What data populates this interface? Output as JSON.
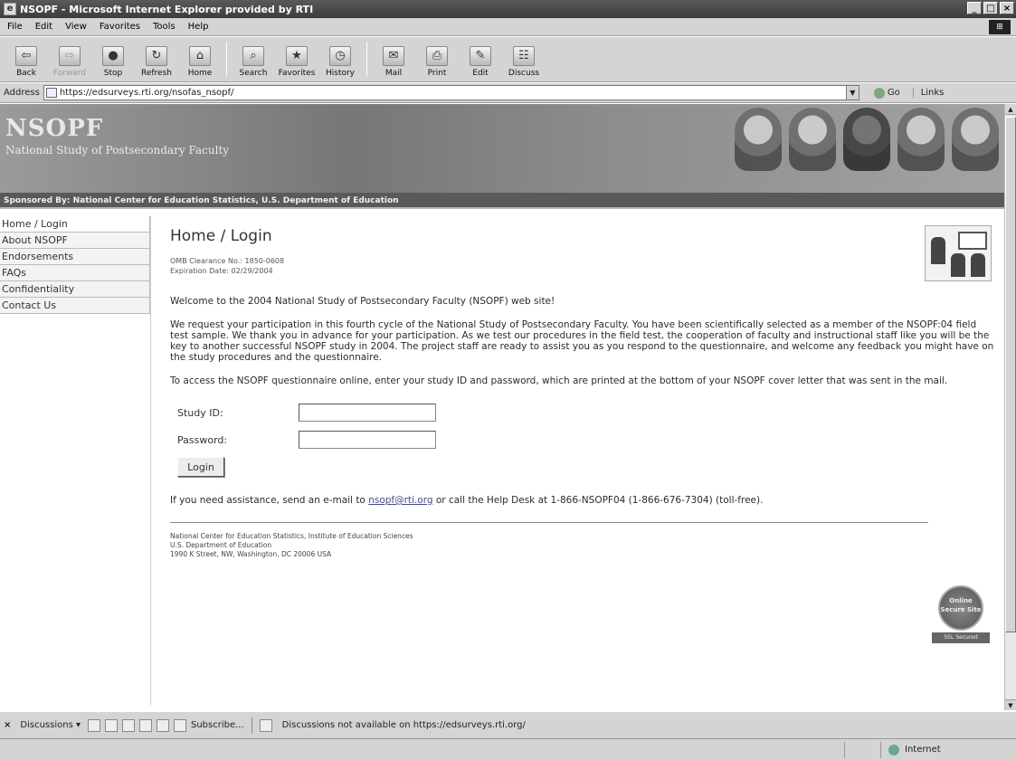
{
  "window": {
    "title": "NSOPF - Microsoft Internet Explorer provided by RTI",
    "min": "_",
    "max": "□",
    "close": "×"
  },
  "menu": [
    "File",
    "Edit",
    "View",
    "Favorites",
    "Tools",
    "Help"
  ],
  "toolbar": [
    {
      "label": "Back",
      "icon": "⇦"
    },
    {
      "label": "Forward",
      "icon": "⇨"
    },
    {
      "label": "Stop",
      "icon": "●"
    },
    {
      "label": "Refresh",
      "icon": "↻"
    },
    {
      "label": "Home",
      "icon": "⌂"
    },
    {
      "label": "Search",
      "icon": "⌕"
    },
    {
      "label": "Favorites",
      "icon": "★"
    },
    {
      "label": "History",
      "icon": "◷"
    },
    {
      "label": "Mail",
      "icon": "✉"
    },
    {
      "label": "Print",
      "icon": "⎙"
    },
    {
      "label": "Edit",
      "icon": "✎"
    },
    {
      "label": "Discuss",
      "icon": "☷"
    }
  ],
  "address": {
    "label": "Address",
    "url": "https://edsurveys.rti.org/nsofas_nsopf/",
    "go": "Go",
    "links": "Links"
  },
  "banner": {
    "logo": "NSOPF",
    "subtitle": "National Study of Postsecondary Faculty",
    "sponsor": "Sponsored By: National Center for Education Statistics, U.S. Department of Education"
  },
  "nav": [
    "Home / Login",
    "About NSOPF",
    "Endorsements",
    "FAQs",
    "Confidentiality",
    "Contact Us"
  ],
  "main": {
    "title": "Home / Login",
    "omb": "OMB Clearance No.: 1850-0608",
    "expiration": "Expiration Date: 02/29/2004",
    "welcome": "Welcome to the 2004 National Study of Postsecondary Faculty (NSOPF) web site!",
    "request": "We request your participation in this fourth cycle of the National Study of Postsecondary Faculty. You have been scientifically selected as a member of the NSOPF:04 field test sample. We thank you in advance for your participation. As we test our procedures in the field test, the cooperation of faculty and instructional staff like you will be the key to another successful NSOPF study in 2004. The project staff are ready to assist you as you respond to the questionnaire, and welcome any feedback you might have on the study procedures and the questionnaire.",
    "access": "To access the NSOPF questionnaire online, enter your study ID and password, which are printed at the bottom of your NSOPF cover letter that was sent in the mail.",
    "study_id_label": "Study ID:",
    "study_id_value": "",
    "password_label": "Password:",
    "password_value": "",
    "login_button": "Login",
    "assist_pre": "If you need assistance, send an e-mail to ",
    "assist_email": "nsopf@rti.org",
    "assist_post": " or call the Help Desk at 1-866-NSOPF04 (1-866-676-7304) (toll-free).",
    "footer_line1": "National Center for Education Statistics, Institute of Education Sciences",
    "footer_line2": "U.S. Department of Education",
    "footer_line3": "1990 K Street, NW, Washington, DC 20006 USA"
  },
  "seal": {
    "text": "Online Secure Site",
    "tag": "SSL Secured"
  },
  "discussions": {
    "label": "Discussions ▾",
    "subscribe": "Subscribe...",
    "message": "Discussions not available on https://edsurveys.rti.org/"
  },
  "status": {
    "zone": "Internet"
  }
}
